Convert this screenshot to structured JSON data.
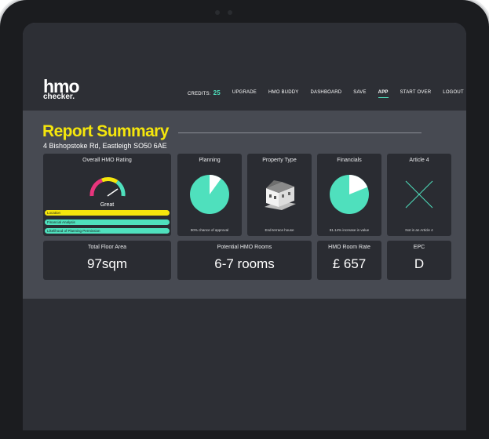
{
  "logo": {
    "line1": "hmo",
    "line2": "checker."
  },
  "nav": {
    "credits_label": "CREDITS:",
    "credits_value": "25",
    "items": [
      "UPGRADE",
      "HMO BUDDY",
      "DASHBOARD",
      "SAVE",
      "APP",
      "START OVER",
      "LOGOUT"
    ],
    "active": "APP"
  },
  "report": {
    "title": "Report Summary",
    "address": "4 Bishopstoke Rd, Eastleigh SO50 6AE"
  },
  "cards": {
    "rating": {
      "title": "Overall HMO Rating",
      "value": "Great",
      "gauge_fraction": 0.85,
      "bars": [
        {
          "label": "Location",
          "color": "#f5e60c",
          "fill": 1.0
        },
        {
          "label": "Financial Analysis",
          "color": "#4fe0bd",
          "fill": 1.0
        },
        {
          "label": "Likelihood of Planning Permission",
          "color": "#4fe0bd",
          "fill": 1.0
        }
      ]
    },
    "planning": {
      "title": "Planning",
      "caption": "90% chance of approval",
      "percent": 90
    },
    "property": {
      "title": "Property Type",
      "caption": "End-terrace house"
    },
    "financials": {
      "title": "Financials",
      "caption": "81.14% increase in value",
      "percent": 81.14
    },
    "article4": {
      "title": "Article 4",
      "caption": "Not in an Article 4"
    },
    "floor_area": {
      "title": "Total Floor Area",
      "value": "97sqm"
    },
    "rooms": {
      "title": "Potential HMO Rooms",
      "value": "6-7 rooms"
    },
    "room_rate": {
      "title": "HMO Room Rate",
      "value": "£ 657"
    },
    "epc": {
      "title": "EPC",
      "value": "D"
    }
  },
  "colors": {
    "accent": "#4fe0bd",
    "brand": "#f5e60c",
    "gauge_pink": "#e8357d"
  },
  "icons": [
    "user-icon",
    "house-image",
    "cross-icon",
    "gauge-icon"
  ]
}
